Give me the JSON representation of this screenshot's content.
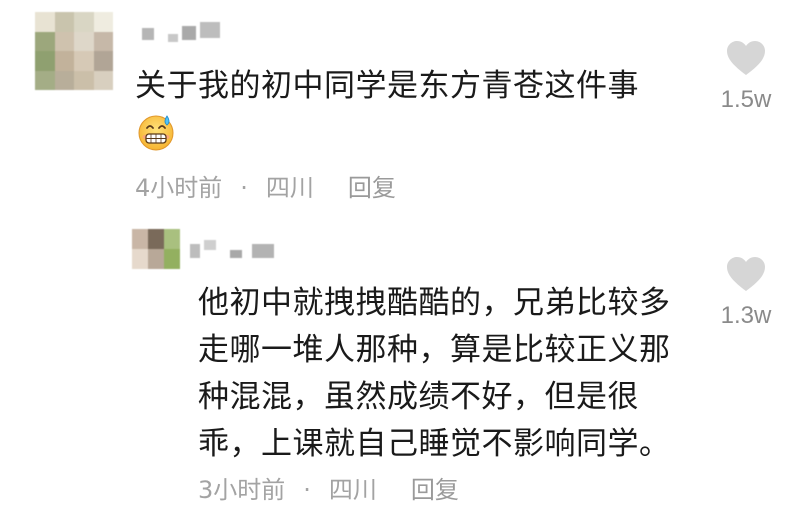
{
  "comments": [
    {
      "text": "关于我的初中同学是东方青苍这件事",
      "emoji": "anxious-sweat-grin-emoji",
      "time": "4小时前",
      "location": "四川",
      "reply_label": "回复",
      "likes": "1.5w"
    },
    {
      "text_lines": [
        "他初中就拽拽酷酷的，兄弟比较多",
        "走哪一堆人那种，算是比较正义那",
        "种混混，虽然成绩不好，但是很",
        "乖，上课就自己睡觉不影响同学。"
      ],
      "time": "3小时前",
      "location": "四川",
      "reply_label": "回复",
      "likes": "1.3w"
    }
  ],
  "separator": "·",
  "colors": {
    "text": "#1a1a1a",
    "meta": "#a3a3a3",
    "heart": "#d6d6d6"
  }
}
